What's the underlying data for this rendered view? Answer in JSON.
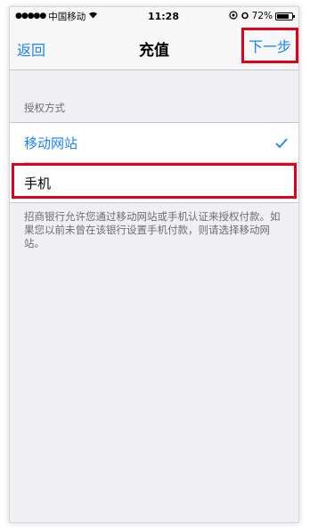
{
  "statusbar": {
    "carrier": "中国移动",
    "time": "11:28",
    "battery": "72%"
  },
  "navbar": {
    "back_label": "返回",
    "title": "充值",
    "next_label": "下一步"
  },
  "section": {
    "header": "授权方式",
    "items": [
      {
        "label": "移动网站",
        "selected": true
      },
      {
        "label": "手机",
        "selected": false
      }
    ],
    "footer": "招商银行允许您通过移动网站或手机认证来授权付款。如果您以前未曾在该银行设置手机付款，则请选择移动网站。"
  },
  "colors": {
    "accent": "#1a82fb",
    "highlight": "#e2001a",
    "background": "#efeff4"
  },
  "icons": {
    "check": "checkmark-icon",
    "wifi": "wifi-icon",
    "battery": "battery-icon"
  }
}
